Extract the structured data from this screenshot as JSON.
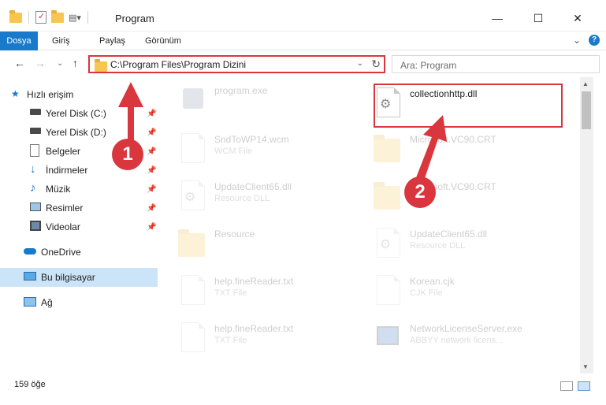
{
  "window": {
    "title": "Program",
    "minimize": "—",
    "maximize": "☐",
    "close": "✕"
  },
  "ribbon": {
    "tabs": [
      "Dosya",
      "Giriş",
      "Paylaş",
      "Görünüm"
    ],
    "expand": "⌄",
    "help": "?"
  },
  "nav": {
    "back": "←",
    "forward": "→",
    "recent": "⌄",
    "up": "↑",
    "address": "C:\\Program Files\\Program Dizini",
    "address_dropdown": "⌄",
    "refresh": "↻",
    "search_placeholder": "Ara: Program",
    "search_icon": "🔍"
  },
  "sidebar": {
    "items": [
      {
        "label": "Hızlı erişim",
        "icon": "star-icon",
        "pinned": false
      },
      {
        "label": "Yerel Disk (C:)",
        "icon": "drive-icon",
        "pinned": true
      },
      {
        "label": "Yerel Disk (D:)",
        "icon": "drive-icon",
        "pinned": true
      },
      {
        "label": "Belgeler",
        "icon": "documents-icon",
        "pinned": true
      },
      {
        "label": "İndirmeler",
        "icon": "download-icon",
        "pinned": true
      },
      {
        "label": "Müzik",
        "icon": "music-icon",
        "pinned": true
      },
      {
        "label": "Resimler",
        "icon": "pictures-icon",
        "pinned": true
      },
      {
        "label": "Videolar",
        "icon": "video-icon",
        "pinned": true
      },
      {
        "label": "OneDrive",
        "icon": "cloud-icon",
        "pinned": false
      },
      {
        "label": "Bu bilgisayar",
        "icon": "computer-icon",
        "pinned": false
      },
      {
        "label": "Ağ",
        "icon": "network-icon",
        "pinned": false
      }
    ],
    "pin_glyph": "📌"
  },
  "files": [
    {
      "name": "program.exe",
      "type": "",
      "kind": "exe",
      "faded": true
    },
    {
      "name": "collectionhttp.dll",
      "type": "",
      "kind": "dll",
      "faded": false
    },
    {
      "name": "SndToWP14.wcm",
      "type": "WCM File",
      "kind": "doc",
      "faded": true
    },
    {
      "name": "Microsoft.VC90.CRT",
      "type": "",
      "kind": "folder",
      "faded": true
    },
    {
      "name": "UpdateClient65.dll",
      "type": "Resource DLL",
      "kind": "dll",
      "faded": true
    },
    {
      "name": "Microsoft.VC90.CRT",
      "type": "",
      "kind": "folder",
      "faded": true
    },
    {
      "name": "Resource",
      "type": "",
      "kind": "folder",
      "faded": true
    },
    {
      "name": "UpdateClient65.dll",
      "type": "Resource DLL",
      "kind": "dll",
      "faded": true
    },
    {
      "name": "help.fineReader.txt",
      "type": "TXT File",
      "kind": "doc",
      "faded": true
    },
    {
      "name": "Korean.cjk",
      "type": "CJK File",
      "kind": "doc",
      "faded": true
    },
    {
      "name": "help.fineReader.txt",
      "type": "TXT File",
      "kind": "doc",
      "faded": true
    },
    {
      "name": "NetworkLicenseServer.exe",
      "type": "ABBYY network licens...",
      "kind": "exe",
      "faded": true
    }
  ],
  "status": {
    "count": "159 öğe"
  },
  "annotations": {
    "step1": "1",
    "step2": "2",
    "color": "#d9363e"
  },
  "colors": {
    "accent": "#1979ca",
    "selected": "#cce4f7",
    "highlight": "#d9363e"
  }
}
